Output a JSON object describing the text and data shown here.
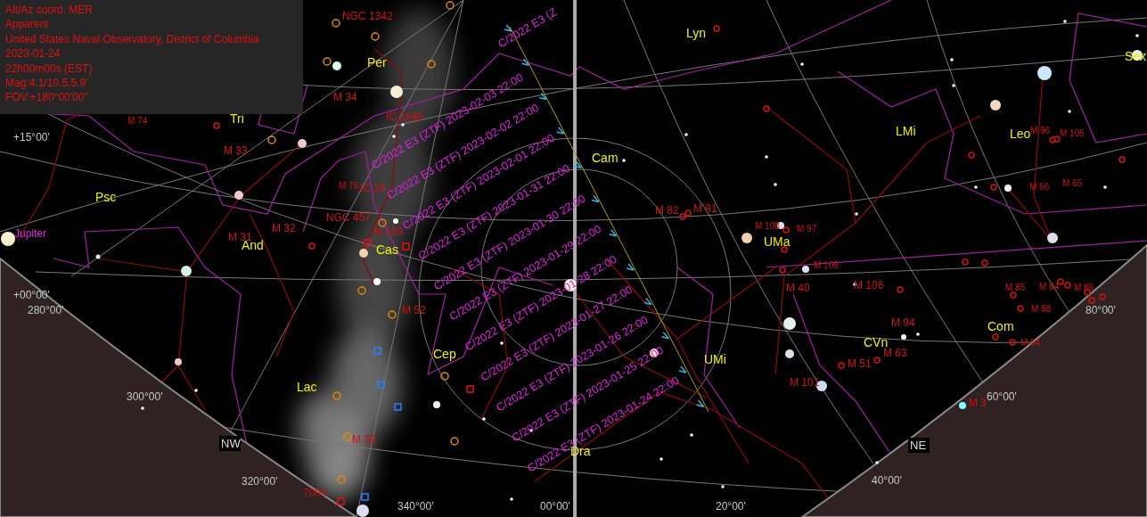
{
  "info_panel": {
    "lines": [
      "Alt/Az coord. MER",
      "Apparent",
      "United States Naval Observatory, District of Columbia",
      "2023-01-24",
      "22h00m00s (EST)",
      "Mag:4.1/10.5,5.9'",
      "FOV:+180°00'00\""
    ]
  },
  "constellation_labels": [
    "Per",
    "Tri",
    "Psc",
    "And",
    "Cas",
    "Lac",
    "Cep",
    "Cam",
    "Lyn",
    "LMi",
    "Leo",
    "Sex",
    "UMa",
    "UMi",
    "Dra",
    "CVn",
    "Com"
  ],
  "deep_sky_labels": [
    "NGC 1342",
    "M 34",
    "IC 1848",
    "M 74",
    "M 33",
    "M 76",
    "IC 18",
    "NGC 457",
    "M 32",
    "M 103",
    "M 31",
    "M 52",
    "M 39",
    "7000",
    "M 82",
    "M 81",
    "M 108",
    "M 97",
    "M 109",
    "M 40",
    "M 106",
    "M 94",
    "M 63",
    "M 51",
    "M 101",
    "M 3",
    "M 85",
    "M 84",
    "M 86",
    "M 88",
    "M 64",
    "M 96",
    "M 105",
    "M 66",
    "M 65"
  ],
  "comet_labels": [
    "C/2022 E3 (Z",
    "C/2022 E3 (ZTF) 2023-02-03 22:00",
    "C/2022 E3 (ZTF) 2023-02-02 22:00",
    "C/2022 E3 (ZTF) 2023-02-01 22:00",
    "C/2022 E3 (ZTF) 2023-01-31 22:00",
    "C/2022 E3 (ZTF) 2023-01-30 22:00",
    "C/2022 E3 (ZTF) 2023-01-29 22:00",
    "C/2022 E3 (ZTF) 2023-01-28 22:00",
    "C/2022 E3 (ZTF) 2023-01-27 22:00",
    "C/2022 E3 (ZTF) 2023-01-26 22:00",
    "C/2022 E3 (ZTF) 2023-01-25 22:00",
    "C/2022 E3 (ZTF) 2023-01-24 22:00"
  ],
  "planet_labels": [
    "Jupiter"
  ],
  "grid_labels": [
    "+15°00'",
    "+00°00'",
    "280°00'",
    "300°00'",
    "320°00'",
    "340°00'",
    "00°00'",
    "20°00'",
    "40°00'",
    "60°00'",
    "80°00'"
  ],
  "direction_labels": [
    "NW",
    "NE"
  ]
}
